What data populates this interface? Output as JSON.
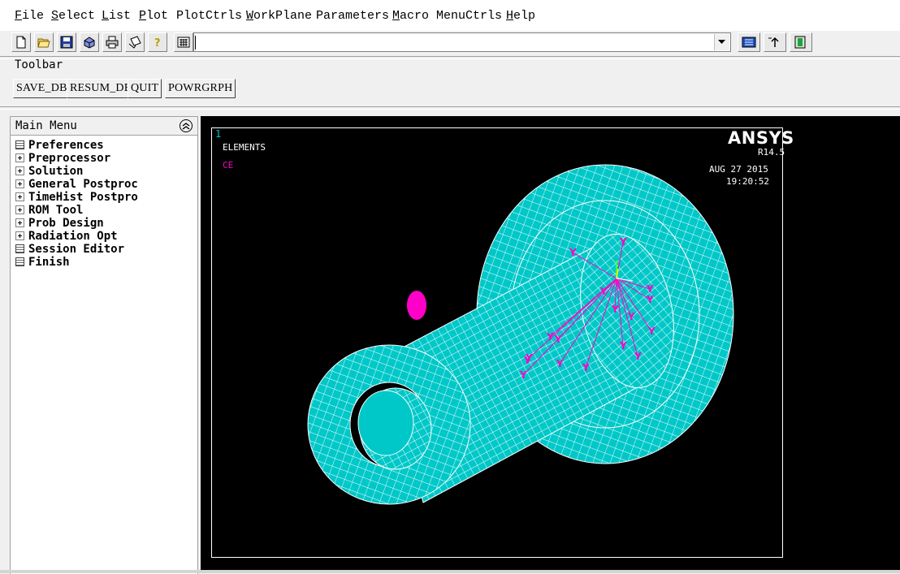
{
  "menubar": {
    "items": [
      {
        "label": "File",
        "u": "F",
        "rest": "ile"
      },
      {
        "label": "Select",
        "u": "S",
        "rest": "elect"
      },
      {
        "label": "List",
        "u": "L",
        "rest": "ist"
      },
      {
        "label": "Plot",
        "u": "P",
        "rest": "lot"
      },
      {
        "label": "PlotCtrls",
        "u": "",
        "rest": "PlotCtrls"
      },
      {
        "label": "WorkPlane",
        "u": "W",
        "rest": "orkPlane"
      },
      {
        "label": "Parameters",
        "u": "",
        "rest": "Parameters"
      },
      {
        "label": "Macro",
        "u": "M",
        "rest": "acro"
      },
      {
        "label": "MenuCtrls",
        "u": "",
        "rest": "MenuCtrls"
      },
      {
        "label": "Help",
        "u": "H",
        "rest": "elp"
      }
    ]
  },
  "command_input": {
    "value": ""
  },
  "toolbar": {
    "label": "Toolbar",
    "buttons": [
      "SAVE_DB",
      "RESUM_DB",
      "QUIT",
      "POWRGRPH"
    ]
  },
  "main_menu": {
    "title": "Main Menu",
    "items": [
      {
        "label": "Preferences",
        "icon": "leaf-icon"
      },
      {
        "label": "Preprocessor",
        "icon": "expand-icon"
      },
      {
        "label": "Solution",
        "icon": "expand-icon"
      },
      {
        "label": "General Postproc",
        "icon": "expand-icon"
      },
      {
        "label": "TimeHist Postpro",
        "icon": "expand-icon"
      },
      {
        "label": "ROM Tool",
        "icon": "expand-icon"
      },
      {
        "label": "Prob Design",
        "icon": "expand-icon"
      },
      {
        "label": "Radiation Opt",
        "icon": "expand-icon"
      },
      {
        "label": "Session Editor",
        "icon": "leaf-icon"
      },
      {
        "label": "Finish",
        "icon": "leaf-icon"
      }
    ]
  },
  "graphics": {
    "window_number": "1",
    "plot_type": "ELEMENTS",
    "constraint_label": "CE",
    "brand": "ANSYS",
    "version": "R14.5",
    "date": "AUG 27 2015",
    "time": "19:20:52",
    "colors": {
      "mesh": "#00c8c8",
      "ce": "#ff00c8",
      "background": "#000000"
    }
  }
}
